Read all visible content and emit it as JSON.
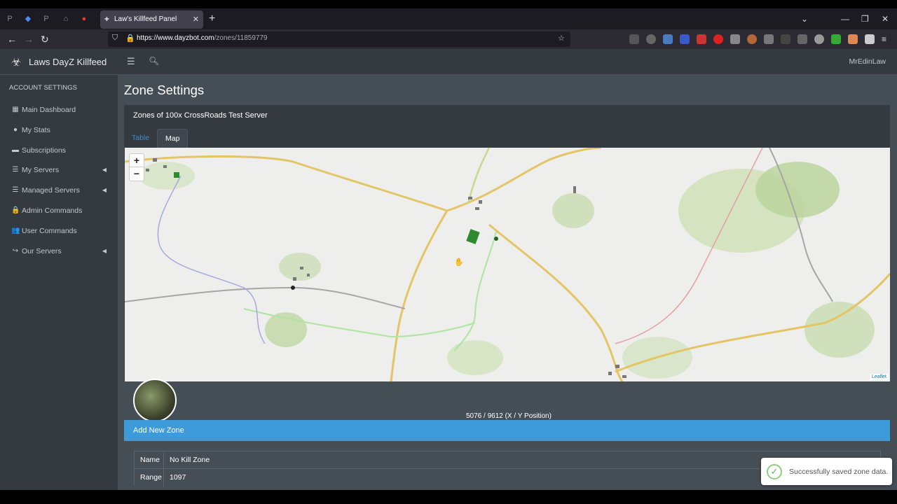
{
  "browser": {
    "tab_title": "Law's Killfeed Panel",
    "url_host": "https://www.dayzbot.com",
    "url_path": "/zones/11859779",
    "icons": {
      "back": "arrow-left-icon",
      "forward": "arrow-right-icon",
      "reload": "reload-icon",
      "star": "bookmark-star-icon",
      "close": "close-icon"
    }
  },
  "app": {
    "brand": "Laws DayZ Killfeed",
    "user": "MrEdinLaw",
    "sidebar": {
      "header": "ACCOUNT SETTINGS",
      "items": [
        {
          "label": "Main Dashboard",
          "icon": "dashboard-icon",
          "glyph": "▦",
          "chevron": false
        },
        {
          "label": "My Stats",
          "icon": "user-circle-icon",
          "glyph": "●",
          "chevron": false
        },
        {
          "label": "Subscriptions",
          "icon": "credit-card-icon",
          "glyph": "▬",
          "chevron": false
        },
        {
          "label": "My Servers",
          "icon": "server-icon",
          "glyph": "☰",
          "chevron": true
        },
        {
          "label": "Managed Servers",
          "icon": "server-icon",
          "glyph": "☰",
          "chevron": true
        },
        {
          "label": "Admin Commands",
          "icon": "lock-icon",
          "glyph": "🔒",
          "chevron": false
        },
        {
          "label": "User Commands",
          "icon": "users-icon",
          "glyph": "👥",
          "chevron": false
        },
        {
          "label": "Our Servers",
          "icon": "share-icon",
          "glyph": "↪",
          "chevron": true
        }
      ]
    },
    "page_title": "Zone Settings",
    "card_title": "Zones of 100x CrossRoads Test Server",
    "tabs": [
      {
        "label": "Table",
        "active": false
      },
      {
        "label": "Map",
        "active": true
      }
    ],
    "map": {
      "zoom_in": "+",
      "zoom_out": "−",
      "attribution": "Leaflet"
    },
    "coord_readout": "5076 / 9612 (X / Y Position)",
    "add_zone_header": "Add New Zone",
    "zone_fields": [
      {
        "key": "Name",
        "value": "No Kill Zone"
      },
      {
        "key": "Range",
        "value": "1097"
      }
    ],
    "toast": "Successfully saved zone data."
  }
}
